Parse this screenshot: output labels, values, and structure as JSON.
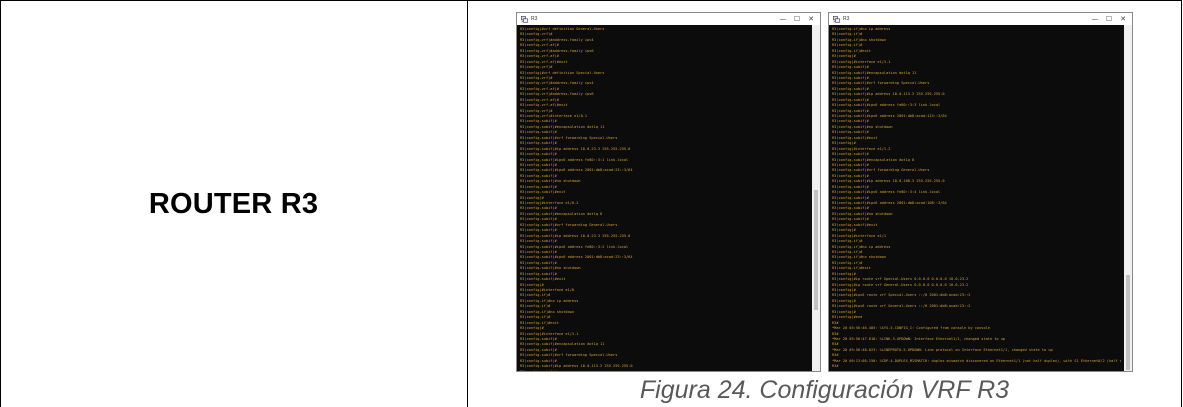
{
  "table": {
    "left_label": "ROUTER R3",
    "caption": "Figura 24. Configuración VRF R3"
  },
  "windows": [
    {
      "title": "R3",
      "controls": [
        "—",
        "☐",
        "✕"
      ],
      "lines": [
        "R3(config)#vrf definition General-Users",
        "R3(config-vrf)#",
        "R3(config-vrf)#address-family ipv4",
        "R3(config-vrf-af)#",
        "R3(config-vrf)#address-family ipv6",
        "R3(config-vrf-af)#",
        "R3(config-vrf-af)#exit",
        "R3(config-vrf)#",
        "R3(config)#vrf definition Special-Users",
        "R3(config-vrf)#",
        "R3(config-vrf)#address-family ipv4",
        "R3(config-vrf-af)#",
        "R3(config-vrf)#address-family ipv6",
        "R3(config-vrf-af)#",
        "R3(config-vrf-af)#exit",
        "R3(config-vrf)#",
        "R3(config-vrf)#interface e1/0.1",
        "R3(config-subif)#",
        "R3(config-subif)#encapsulation dot1q 11",
        "R3(config-subif)#",
        "R3(config-subif)#vrf forwarding Special-Users",
        "R3(config-subif)#",
        "R3(config-subif)#ip address 10.0.23.3 255.255.255.0",
        "R3(config-subif)#",
        "R3(config-subif)#ipv6 address fe80::3:1 link-local",
        "R3(config-subif)#",
        "R3(config-subif)#ipv6 address 2001:db8:acad:23::3/64",
        "R3(config-subif)#",
        "R3(config-subif)#no shutdown",
        "R3(config-subif)#",
        "R3(config-subif)#exit",
        "R3(config)#",
        "R3(config)#interface e1/0.2",
        "R3(config-subif)#",
        "R3(config-subif)#encapsulation dot1q 8",
        "R3(config-subif)#",
        "R3(config-subif)#vrf forwarding General-Users",
        "R3(config-subif)#",
        "R3(config-subif)#ip address 10.0.23.3 255.255.255.0",
        "R3(config-subif)#",
        "R3(config-subif)#ipv6 address fe80::3:2 link-local",
        "R3(config-subif)#",
        "R3(config-subif)#ipv6 address 2001:db8:acad:23::3/64",
        "R3(config-subif)#",
        "R3(config-subif)#no shutdown",
        "R3(config-subif)#",
        "R3(config-subif)#exit",
        "R3(config)#",
        "R3(config)#interface e1/0",
        "R3(config-if)#",
        "R3(config-if)#no ip address",
        "R3(config-if)#",
        "R3(config-if)#no shutdown",
        "R3(config-if)#",
        "R3(config-if)#exit",
        "R3(config)#",
        "R3(config)#interface e1/1.1",
        "R3(config-subif)#",
        "R3(config-subif)#encapsulation dot1q 11",
        "R3(config-subif)#",
        "R3(config-subif)#vrf forwarding Special-Users",
        "R3(config-subif)#",
        "R3(config-subif)#ip address 10.0.113.3 255.255.255.0",
        "R3(config-subif)#",
        "R3(config-subif)#ipv6 address fe80::3:3 link-local",
        "R3(config-subif)#",
        "R3(config-subif)#ipv6 address 2001:db8:acad:113::3/64"
      ]
    },
    {
      "title": "R3",
      "controls": [
        "—",
        "☐",
        "✕"
      ],
      "lines": [
        "R3(config-if)#no ip address",
        "R3(config-if)#",
        "R3(config-if)#no shutdown",
        "R3(config-if)#",
        "R3(config-if)#exit",
        "R3(config)#",
        "R3(config)#interface e1/1.1",
        "R3(config-subif)#",
        "R3(config-subif)#encapsulation dot1q 11",
        "R3(config-subif)#",
        "R3(config-subif)#vrf forwarding Special-Users",
        "R3(config-subif)#",
        "R3(config-subif)#ip address 10.0.113.3 255.255.255.0",
        "R3(config-subif)#",
        "R3(config-subif)#ipv6 address fe80::3:3 link-local",
        "R3(config-subif)#",
        "R3(config-subif)#ipv6 address 2001:db8:acad:113::3/64",
        "R3(config-subif)#",
        "R3(config-subif)#no shutdown",
        "R3(config-subif)#",
        "R3(config-subif)#exit",
        "R3(config)#",
        "R3(config)#interface e1/1.2",
        "R3(config-subif)#",
        "R3(config-subif)#encapsulation dot1q 8",
        "R3(config-subif)#",
        "R3(config-subif)#vrf forwarding General-Users",
        "R3(config-subif)#",
        "R3(config-subif)#ip address 10.0.108.3 255.255.255.0",
        "R3(config-subif)#",
        "R3(config-subif)#ipv6 address fe80::3:4 link-local",
        "R3(config-subif)#",
        "R3(config-subif)#ipv6 address 2001:db8:acad:108::3/64",
        "R3(config-subif)#",
        "R3(config-subif)#no shutdown",
        "R3(config-subif)#",
        "R3(config-subif)#exit",
        "R3(config)#",
        "R3(config)#interface e1/1",
        "R3(config-if)#",
        "R3(config-if)#no ip address",
        "R3(config-if)#",
        "R3(config-if)#no shutdown",
        "R3(config-if)#",
        "R3(config-if)#exit",
        "R3(config)#",
        "R3(config)#ip route vrf Special-Users 0.0.0.0 0.0.0.0 10.0.23.2",
        "R3(config)#ip route vrf General-Users 0.0.0.0 0.0.0.0 10.0.23.2",
        "R3(config)#",
        "R3(config)#ipv6 route vrf Special-Users ::/0 2001:db8:acad:23::2",
        "R3(config)#",
        "R3(config)#ipv6 route vrf General-Users ::/0 2001:db8:acad:23::2",
        "R3(config)#",
        "R3(config)#end",
        "R3#",
        "*Mar 20 05:56:46.485: %SYS-5-CONFIG_I: Configured from console by console",
        "R3#",
        "*Mar 20 05:56:47.018: %LINK-3-UPDOWN: Interface Ethernet1/1, changed state to up",
        "R3#",
        "*Mar 20 05:56:48.023: %LINEPROTO-5-UPDOWN: Line protocol on Interface Ethernet1/1, changed state to up",
        "R3#",
        "*Mar 20 06:13:08.150: %CDP-4-DUPLEX_MISMATCH: duplex mismatch discovered on Ethernet1/1 (not half duplex), with S1 Ethernet0/2 (half d",
        "R3#"
      ]
    }
  ]
}
